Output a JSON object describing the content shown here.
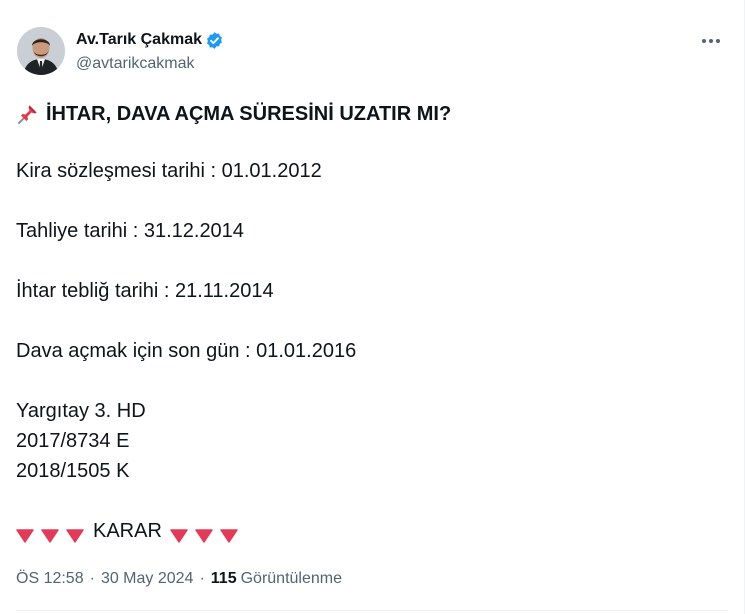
{
  "author": {
    "display_name": "Av.Tarık Çakmak",
    "handle": "@avtarikcakmak",
    "verified": true,
    "avatar_icon": "profile-photo"
  },
  "more_icon": "more-horizontal-icon",
  "post": {
    "title_emoji": "pushpin-icon",
    "title": "İHTAR, DAVA AÇMA SÜRESİNİ UZATIR MI?",
    "lines": [
      "Kira sözleşmesi tarihi : 01.01.2012",
      "Tahliye tarihi : 31.12.2014",
      "İhtar tebliğ tarihi : 21.11.2014",
      "Dava açmak için son gün : 01.01.2016",
      "Yargıtay 3. HD",
      "2017/8734 E",
      "2018/1505 K"
    ],
    "karar_label": "KARAR",
    "karar_emoji": "red-down-triangle-icon"
  },
  "meta": {
    "time": "ÖS 12:58",
    "date": "30 May 2024",
    "separator": "·",
    "views_count": "115",
    "views_label": "Görüntülenme"
  },
  "colors": {
    "text": "#0f1419",
    "secondary": "#536471",
    "verified_blue": "#1d9bf0",
    "triangle_red": "#e03c5a",
    "divider": "#eff3f4"
  }
}
